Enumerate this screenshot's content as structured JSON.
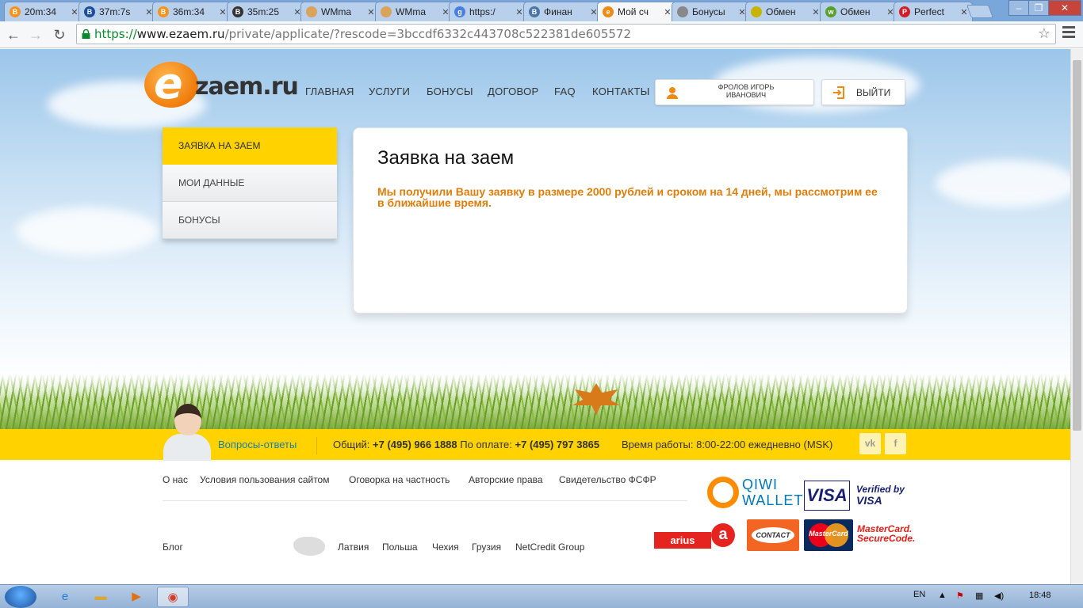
{
  "browser": {
    "tabs": [
      {
        "title": "20m:34",
        "icon": "bitcoin-icon",
        "color": "#f7931a",
        "glyph": "B"
      },
      {
        "title": "37m:7s",
        "icon": "bitcoin-icon",
        "color": "#1b4f9c",
        "glyph": "B"
      },
      {
        "title": "36m:34",
        "icon": "bitcoin-icon",
        "color": "#f7931a",
        "glyph": "B"
      },
      {
        "title": "35m:25",
        "icon": "bitcoin-icon",
        "color": "#333333",
        "glyph": "B"
      },
      {
        "title": "WMma",
        "icon": "wm-icon",
        "color": "#d9a35a",
        "glyph": ""
      },
      {
        "title": "WMma",
        "icon": "wm-icon",
        "color": "#d9a35a",
        "glyph": ""
      },
      {
        "title": "https:/",
        "icon": "google-icon",
        "color": "#4a7fe0",
        "glyph": "g"
      },
      {
        "title": "Финан",
        "icon": "vk-icon",
        "color": "#4a76a8",
        "glyph": "B"
      },
      {
        "title": "Мой сч",
        "icon": "ezaem-icon",
        "color": "#f08a12",
        "glyph": "e"
      },
      {
        "title": "Бонусы",
        "icon": "bonus-icon",
        "color": "#888888",
        "glyph": ""
      },
      {
        "title": "Обмен",
        "icon": "exchange-icon",
        "color": "#c8b400",
        "glyph": ""
      },
      {
        "title": "Обмен",
        "icon": "wm-icon",
        "color": "#5aa02c",
        "glyph": "w"
      },
      {
        "title": "Perfect",
        "icon": "pm-icon",
        "color": "#d01f2a",
        "glyph": "P"
      }
    ],
    "url_scheme": "https://",
    "url_host": "www.ezaem.ru",
    "url_path": "/private/applicate/?rescode=3bccdf6332c443708c522381de605572"
  },
  "site": {
    "logo_e": "e",
    "logo_rest": "zaem.ru",
    "nav": [
      "ГЛАВНАЯ",
      "УСЛУГИ",
      "БОНУСЫ",
      "ДОГОВОР",
      "FAQ",
      "КОНТАКТЫ"
    ],
    "user_name_line1": "ФРОЛОВ ИГОРЬ",
    "user_name_line2": "ИВАНОВИЧ",
    "logout_label": "ВЫЙТИ"
  },
  "sidebar": {
    "items": [
      {
        "label": "ЗАЯВКА НА ЗАЕМ",
        "active": true
      },
      {
        "label": "МОИ ДАННЫЕ",
        "active": false
      },
      {
        "label": "БОНУСЫ",
        "active": false
      }
    ]
  },
  "main": {
    "title": "Заявка на заем",
    "message": "Мы получили Вашу заявку в размере 2000 рублей и сроком на 14 дней, мы рассмотрим ее в ближайшие время."
  },
  "contact_bar": {
    "faq_link": "Вопросы-ответы",
    "general_label": "Общий:",
    "general_phone": "+7 (495) 966 1888",
    "payment_label": "По оплате:",
    "payment_phone": "+7 (495) 797 3865",
    "hours": "Время работы: 8:00-22:00 ежедневно (MSK)",
    "vk": "vk",
    "fb": "f"
  },
  "footer": {
    "links": [
      "О нас",
      "Условия пользования сайтом",
      "Оговорка на частность",
      "Авторские права",
      "Свидетельство ФСФР"
    ],
    "blog": "Блог",
    "countries": [
      "Латвия",
      "Польша",
      "Чехия",
      "Грузия",
      "NetCredit Group"
    ],
    "payments": {
      "qiwi_line1": "QIWI",
      "qiwi_line2": "WALLET",
      "visa": "VISA",
      "vbv_line1": "Verified by",
      "vbv_line2": "VISA",
      "arius": "arius",
      "arius_a": "a",
      "contact": "CONTACT",
      "mastercard": "MasterCard",
      "mc_securecode_line1": "MasterCard.",
      "mc_securecode_line2": "SecureCode."
    }
  },
  "taskbar": {
    "lang": "EN",
    "time": "18:48"
  }
}
